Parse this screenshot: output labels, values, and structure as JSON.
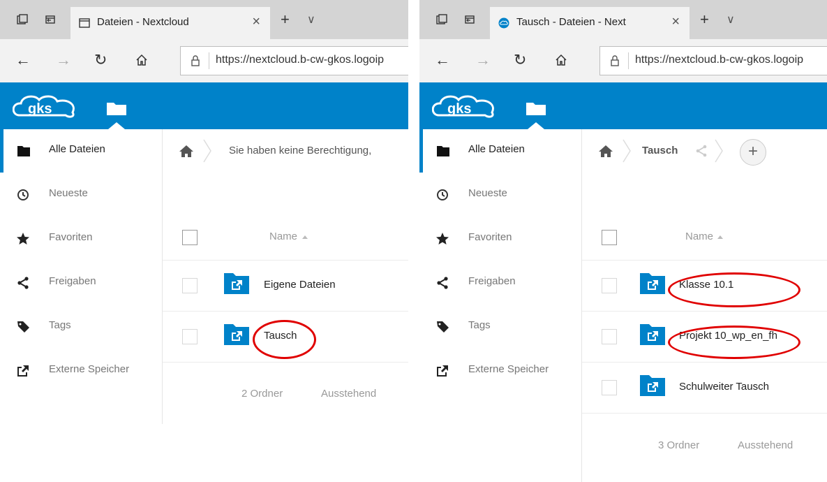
{
  "left": {
    "tab_title": "Dateien - Nextcloud",
    "url": "https://nextcloud.b-cw-gkos.logoip",
    "breadcrumb_message": "Sie haben keine Berechtigung,",
    "column_name": "Name",
    "rows": [
      {
        "name": "Eigene Dateien"
      },
      {
        "name": "Tausch"
      }
    ],
    "summary_count": "2 Ordner",
    "summary_status": "Ausstehend"
  },
  "right": {
    "tab_title": "Tausch - Dateien - Next",
    "url": "https://nextcloud.b-cw-gkos.logoip",
    "breadcrumb_folder": "Tausch",
    "add_label": "+",
    "column_name": "Name",
    "rows": [
      {
        "name": "Klasse 10.1"
      },
      {
        "name": "Projekt 10_wp_en_fh"
      },
      {
        "name": "Schulweiter Tausch"
      }
    ],
    "summary_count": "3 Ordner",
    "summary_status": "Ausstehend"
  },
  "sidebar": {
    "items": [
      {
        "label": "Alle Dateien",
        "icon": "folder-icon"
      },
      {
        "label": "Neueste",
        "icon": "clock-icon"
      },
      {
        "label": "Favoriten",
        "icon": "star-icon"
      },
      {
        "label": "Freigaben",
        "icon": "share-icon"
      },
      {
        "label": "Tags",
        "icon": "tag-icon"
      },
      {
        "label": "Externe Speicher",
        "icon": "external-link-icon"
      }
    ]
  },
  "browser": {
    "new_tab_label": "+",
    "close_glyph": "×",
    "more_glyph": "∨",
    "back_glyph": "←",
    "forward_glyph": "→",
    "refresh_glyph": "↻"
  },
  "colors": {
    "brand_blue": "#0082c9",
    "annotation_red": "#e00000"
  }
}
